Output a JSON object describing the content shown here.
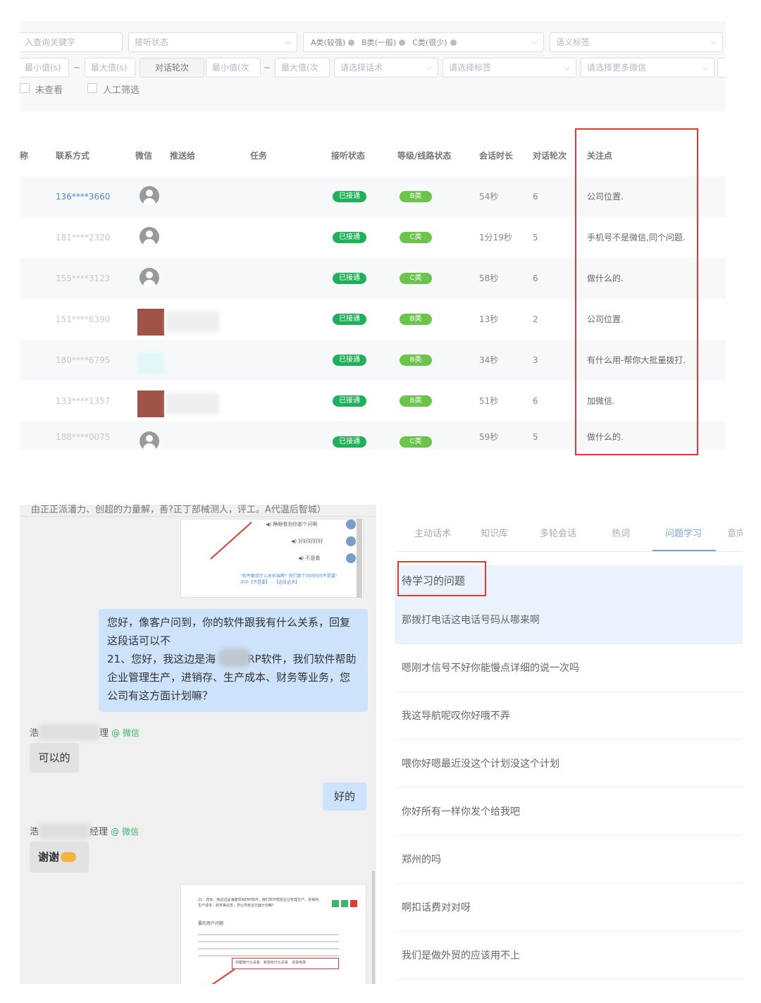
{
  "filters": {
    "keyword_placeholder": "入查询关键字",
    "status_placeholder": "接听状态",
    "grade_chips": [
      "A类(较强)",
      "B类(一般)",
      "C类(很少)"
    ],
    "semantic_placeholder": "语义标签",
    "min_s": "最小值(s)",
    "max_s": "最大值(s)",
    "rounds_label": "对话轮次",
    "min_times": "最小值(次",
    "max_times": "最大值(次",
    "script_placeholder": "请选择话术",
    "tag_placeholder": "请选择标签",
    "wechat_placeholder": "请选择更多微信",
    "range_sep": "~",
    "unviewed": "未查看",
    "manual": "人工筛选"
  },
  "table": {
    "headers": {
      "col0": "称",
      "contact": "联系方式",
      "wechat": "微信",
      "pusher": "推送给",
      "task": "任务",
      "status": "接听状态",
      "grade": "等级/线路状态",
      "duration": "会话时长",
      "rounds": "对话轮次",
      "focus": "关注点"
    },
    "rows": [
      {
        "phone": "136****3660",
        "status": "已接通",
        "grade": "B类",
        "duration": "54秒",
        "rounds": "6",
        "focus": "公司位置."
      },
      {
        "phone": "181****2320",
        "status": "已接通",
        "grade": "C类",
        "duration": "1分19秒",
        "rounds": "5",
        "focus": "手机号不是微信,同个问题."
      },
      {
        "phone": "155****3123",
        "status": "已接通",
        "grade": "C类",
        "duration": "58秒",
        "rounds": "6",
        "focus": "做什么的."
      },
      {
        "phone": "151****6390",
        "status": "已接通",
        "grade": "B类",
        "duration": "13秒",
        "rounds": "2",
        "focus": "公司位置."
      },
      {
        "phone": "180****6795",
        "status": "已接通",
        "grade": "B类",
        "duration": "34秒",
        "rounds": "3",
        "focus": "有什么用-帮你大批量拨打."
      },
      {
        "phone": "133****1357",
        "status": "已接通",
        "grade": "B类",
        "duration": "51秒",
        "rounds": "6",
        "focus": "加微信."
      },
      {
        "phone": "188****0075",
        "status": "已接通",
        "grade": "C类",
        "duration": "59秒",
        "rounds": "5",
        "focus": "做什么的."
      }
    ]
  },
  "chat": {
    "top_cut_text": "由正正派潘力、创超的力量解，善?正丁部械测人，评工。A代温后智城）",
    "shot1_items": [
      "睁眼看到你那个问啊",
      "好好好好好",
      "不是看"
    ],
    "shot1_link": "\"软件跟我什么关系端啊？你们那个问问问问不是要\" 亦中【不是要】 - 【这段话术】",
    "q_bubble": [
      "您好，像客户问到，你的软件跟我有什么关系，回复",
      "这段话可以不",
      "21、您好，我这边是海　　　RP软件，我们软件帮助",
      "企业管理生产，进销存、生产成本、财务等业务，您",
      "公司有这方面计划嘛？"
    ],
    "sender1_prefix": "浩",
    "sender1_suffix": "理",
    "wechat_tag": "@ 微信",
    "reply1": "可以的",
    "reply_ok": "好的",
    "sender2_prefix": "浩",
    "sender2_suffix": "经理",
    "reply2": "谢谢",
    "shot2_text": "21、您好，我这边是海建项目ERP软件，我们软件帮助企业管理生产，进销存、生产成本、财务等业务，您公司有这方面计划嘛？",
    "shot2_title": "要的用户问题",
    "shot2_highlight": "你跟我什么关系　和我有什么关系　关我啥事"
  },
  "qpanel": {
    "tabs": [
      "主动话术",
      "知识库",
      "多轮会话",
      "热词",
      "问题学习",
      "意向"
    ],
    "active_tab": 4,
    "section_title": "待学习的问题",
    "questions": [
      "那拨打电话这电话号码从哪来啊",
      "嗯刚才信号不好你能慢点详细的说一次吗",
      "我这导航呢叹你好哦不弄",
      "喂你好嗯最近没这个计划没这个计划",
      "你好所有一样你发个给我吧",
      "郑州的吗",
      "啊扣话费对对呀",
      "我们是做外贸的应该用不上"
    ]
  }
}
